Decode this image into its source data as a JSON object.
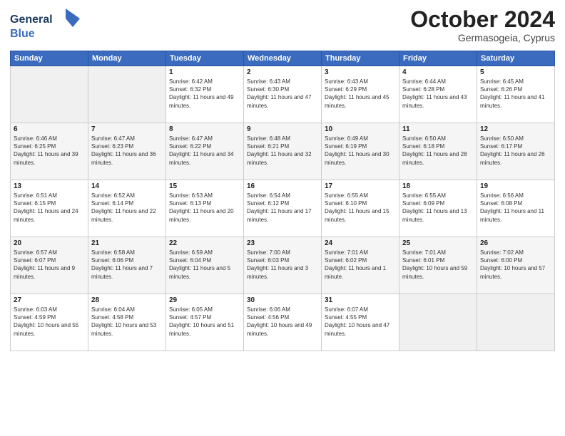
{
  "logo": {
    "line1": "General",
    "line2": "Blue"
  },
  "header": {
    "month": "October 2024",
    "location": "Germasogeia, Cyprus"
  },
  "days_of_week": [
    "Sunday",
    "Monday",
    "Tuesday",
    "Wednesday",
    "Thursday",
    "Friday",
    "Saturday"
  ],
  "weeks": [
    [
      {
        "day": "",
        "empty": true
      },
      {
        "day": "",
        "empty": true
      },
      {
        "day": "1",
        "sunrise": "6:42 AM",
        "sunset": "6:32 PM",
        "daylight": "11 hours and 49 minutes."
      },
      {
        "day": "2",
        "sunrise": "6:43 AM",
        "sunset": "6:30 PM",
        "daylight": "11 hours and 47 minutes."
      },
      {
        "day": "3",
        "sunrise": "6:43 AM",
        "sunset": "6:29 PM",
        "daylight": "11 hours and 45 minutes."
      },
      {
        "day": "4",
        "sunrise": "6:44 AM",
        "sunset": "6:28 PM",
        "daylight": "11 hours and 43 minutes."
      },
      {
        "day": "5",
        "sunrise": "6:45 AM",
        "sunset": "6:26 PM",
        "daylight": "11 hours and 41 minutes."
      }
    ],
    [
      {
        "day": "6",
        "sunrise": "6:46 AM",
        "sunset": "6:25 PM",
        "daylight": "11 hours and 39 minutes."
      },
      {
        "day": "7",
        "sunrise": "6:47 AM",
        "sunset": "6:23 PM",
        "daylight": "11 hours and 36 minutes."
      },
      {
        "day": "8",
        "sunrise": "6:47 AM",
        "sunset": "6:22 PM",
        "daylight": "11 hours and 34 minutes."
      },
      {
        "day": "9",
        "sunrise": "6:48 AM",
        "sunset": "6:21 PM",
        "daylight": "11 hours and 32 minutes."
      },
      {
        "day": "10",
        "sunrise": "6:49 AM",
        "sunset": "6:19 PM",
        "daylight": "11 hours and 30 minutes."
      },
      {
        "day": "11",
        "sunrise": "6:50 AM",
        "sunset": "6:18 PM",
        "daylight": "11 hours and 28 minutes."
      },
      {
        "day": "12",
        "sunrise": "6:50 AM",
        "sunset": "6:17 PM",
        "daylight": "11 hours and 26 minutes."
      }
    ],
    [
      {
        "day": "13",
        "sunrise": "6:51 AM",
        "sunset": "6:15 PM",
        "daylight": "11 hours and 24 minutes."
      },
      {
        "day": "14",
        "sunrise": "6:52 AM",
        "sunset": "6:14 PM",
        "daylight": "11 hours and 22 minutes."
      },
      {
        "day": "15",
        "sunrise": "6:53 AM",
        "sunset": "6:13 PM",
        "daylight": "11 hours and 20 minutes."
      },
      {
        "day": "16",
        "sunrise": "6:54 AM",
        "sunset": "6:12 PM",
        "daylight": "11 hours and 17 minutes."
      },
      {
        "day": "17",
        "sunrise": "6:55 AM",
        "sunset": "6:10 PM",
        "daylight": "11 hours and 15 minutes."
      },
      {
        "day": "18",
        "sunrise": "6:55 AM",
        "sunset": "6:09 PM",
        "daylight": "11 hours and 13 minutes."
      },
      {
        "day": "19",
        "sunrise": "6:56 AM",
        "sunset": "6:08 PM",
        "daylight": "11 hours and 11 minutes."
      }
    ],
    [
      {
        "day": "20",
        "sunrise": "6:57 AM",
        "sunset": "6:07 PM",
        "daylight": "11 hours and 9 minutes."
      },
      {
        "day": "21",
        "sunrise": "6:58 AM",
        "sunset": "6:06 PM",
        "daylight": "11 hours and 7 minutes."
      },
      {
        "day": "22",
        "sunrise": "6:59 AM",
        "sunset": "6:04 PM",
        "daylight": "11 hours and 5 minutes."
      },
      {
        "day": "23",
        "sunrise": "7:00 AM",
        "sunset": "6:03 PM",
        "daylight": "11 hours and 3 minutes."
      },
      {
        "day": "24",
        "sunrise": "7:01 AM",
        "sunset": "6:02 PM",
        "daylight": "11 hours and 1 minute."
      },
      {
        "day": "25",
        "sunrise": "7:01 AM",
        "sunset": "6:01 PM",
        "daylight": "10 hours and 59 minutes."
      },
      {
        "day": "26",
        "sunrise": "7:02 AM",
        "sunset": "6:00 PM",
        "daylight": "10 hours and 57 minutes."
      }
    ],
    [
      {
        "day": "27",
        "sunrise": "6:03 AM",
        "sunset": "4:59 PM",
        "daylight": "10 hours and 55 minutes."
      },
      {
        "day": "28",
        "sunrise": "6:04 AM",
        "sunset": "4:58 PM",
        "daylight": "10 hours and 53 minutes."
      },
      {
        "day": "29",
        "sunrise": "6:05 AM",
        "sunset": "4:57 PM",
        "daylight": "10 hours and 51 minutes."
      },
      {
        "day": "30",
        "sunrise": "6:06 AM",
        "sunset": "4:56 PM",
        "daylight": "10 hours and 49 minutes."
      },
      {
        "day": "31",
        "sunrise": "6:07 AM",
        "sunset": "4:55 PM",
        "daylight": "10 hours and 47 minutes."
      },
      {
        "day": "",
        "empty": true
      },
      {
        "day": "",
        "empty": true
      }
    ]
  ],
  "labels": {
    "sunrise": "Sunrise:",
    "sunset": "Sunset:",
    "daylight": "Daylight:"
  }
}
